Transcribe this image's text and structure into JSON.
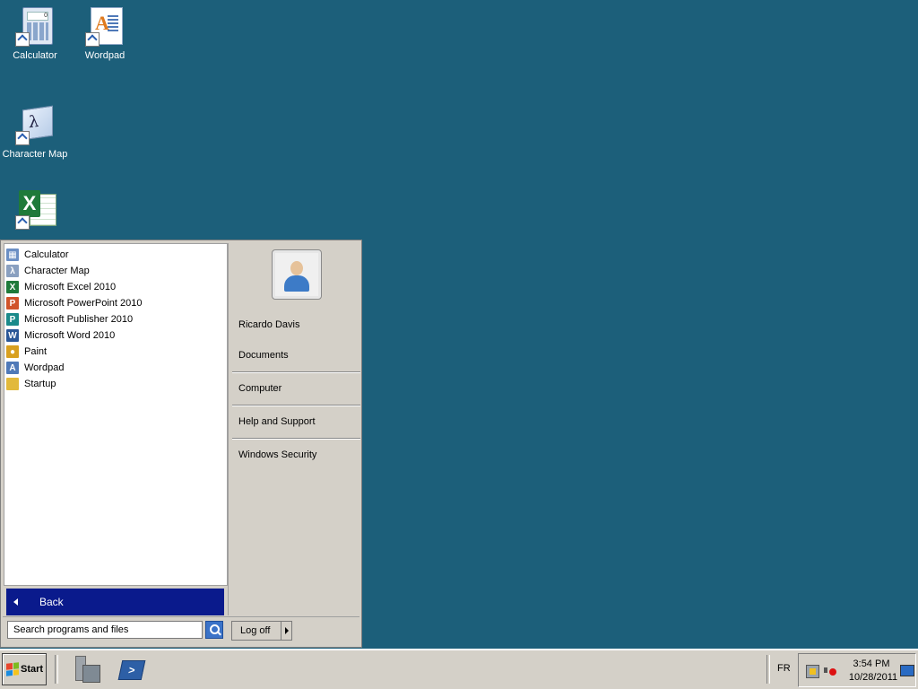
{
  "desktop": {
    "icons": [
      {
        "label": "Calculator"
      },
      {
        "label": "Wordpad"
      },
      {
        "label": "Character Map"
      },
      {
        "label": ""
      }
    ]
  },
  "start_menu": {
    "programs": [
      {
        "label": "Calculator",
        "icon": "calculator-icon",
        "color": "#6b8fc4"
      },
      {
        "label": "Character Map",
        "icon": "character-map-icon",
        "color": "#8aa0c0"
      },
      {
        "label": "Microsoft Excel 2010",
        "icon": "excel-icon",
        "color": "#1f7a3a",
        "glyph": "X"
      },
      {
        "label": "Microsoft PowerPoint 2010",
        "icon": "powerpoint-icon",
        "color": "#d0532a",
        "glyph": "P"
      },
      {
        "label": "Microsoft Publisher 2010",
        "icon": "publisher-icon",
        "color": "#1a8a8a",
        "glyph": "P"
      },
      {
        "label": "Microsoft Word 2010",
        "icon": "word-icon",
        "color": "#2b5797",
        "glyph": "W"
      },
      {
        "label": "Paint",
        "icon": "paint-icon",
        "color": "#d8a020"
      },
      {
        "label": "Wordpad",
        "icon": "wordpad-icon",
        "color": "#4f79b8"
      },
      {
        "label": "Startup",
        "icon": "folder-icon",
        "color": "#e2b93b"
      }
    ],
    "back_label": "Back",
    "search_placeholder": "Search programs and files",
    "right": {
      "user": "Ricardo Davis",
      "documents": "Documents",
      "computer": "Computer",
      "help": "Help and Support",
      "security": "Windows Security"
    },
    "logoff_label": "Log off"
  },
  "taskbar": {
    "start_label": "Start",
    "language": "FR",
    "time": "3:54 PM",
    "date": "10/28/2011"
  },
  "colors": {
    "desktop_bg": "#1c5f7a",
    "back_highlight": "#0a1a8c",
    "chrome": "#d4d0c8"
  }
}
